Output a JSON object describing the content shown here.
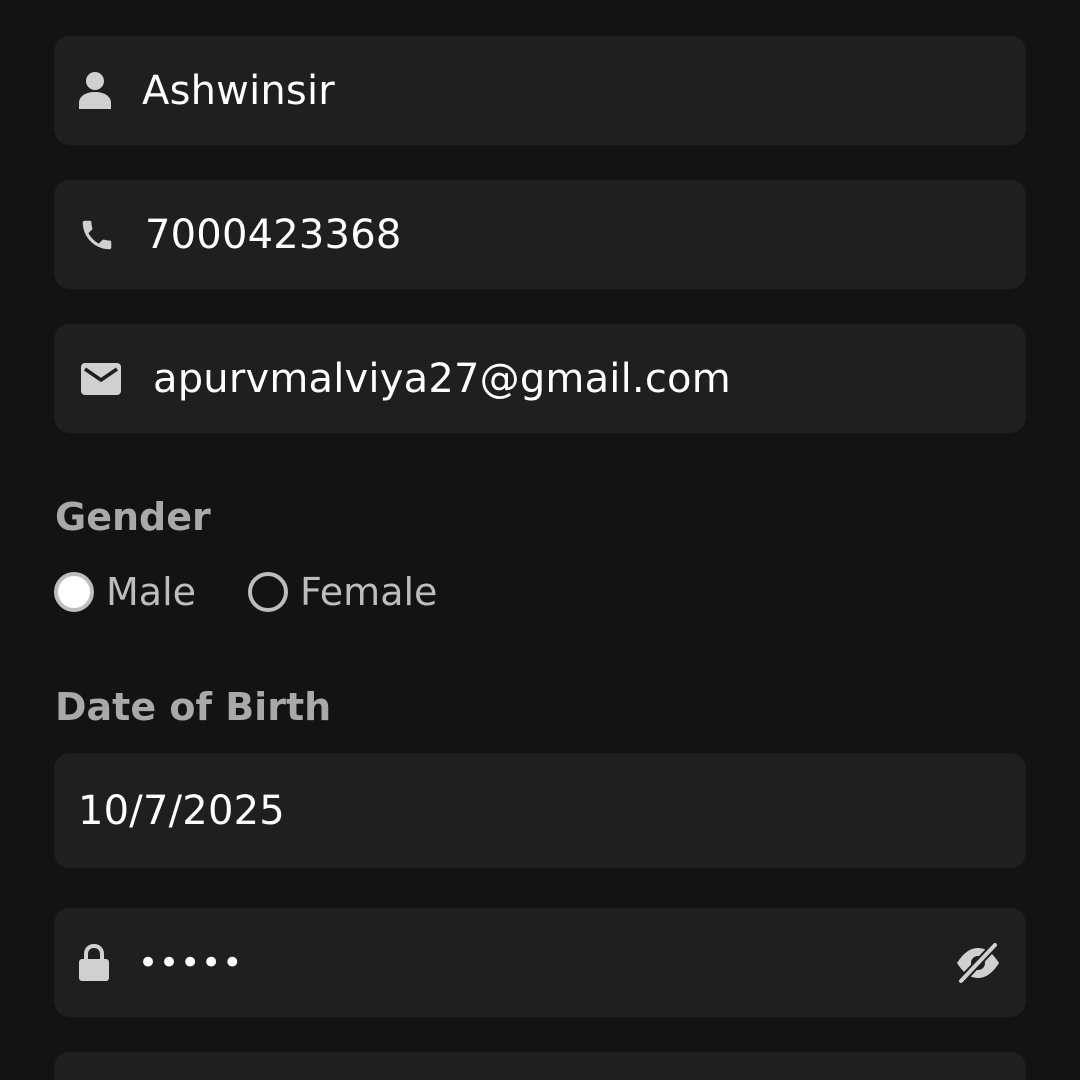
{
  "form": {
    "name": {
      "value": "Ashwinsir",
      "icon": "person-icon"
    },
    "phone": {
      "value": "7000423368",
      "icon": "phone-icon"
    },
    "email": {
      "value": "apurvmalviya27@gmail.com",
      "icon": "mail-icon"
    },
    "gender": {
      "label": "Gender",
      "options": [
        {
          "label": "Male",
          "selected": true
        },
        {
          "label": "Female",
          "selected": false
        }
      ]
    },
    "dob": {
      "label": "Date of Birth",
      "value": "10/7/2025"
    },
    "password": {
      "value": "•••••",
      "icon": "lock-icon",
      "toggle_icon": "eye-off-icon"
    }
  },
  "colors": {
    "background": "#131313",
    "field_background": "#1f1f1f",
    "icon": "#d0d0d0",
    "label": "#a9a9a9",
    "text": "#ffffff"
  }
}
